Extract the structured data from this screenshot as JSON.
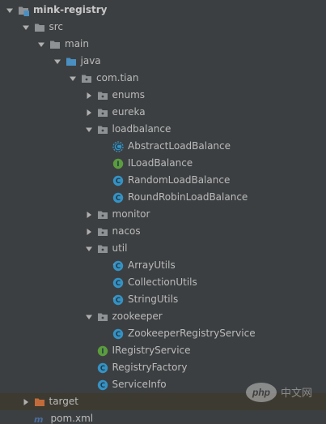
{
  "colors": {
    "background": "#3c3f41",
    "text": "#bbbbbb",
    "folder": "#8f9295",
    "source_folder_accent": "#4a8fc2",
    "excluded_folder": "#c26b3a",
    "class_icon": "#3592c4",
    "interface_icon": "#5b9c3d",
    "maven_icon": "#4a6fa0"
  },
  "tree": [
    {
      "label": "mink-registry",
      "icon": "module-folder-icon",
      "arrow": "down",
      "depth": 0,
      "bold": true
    },
    {
      "label": "src",
      "icon": "folder-icon",
      "arrow": "down",
      "depth": 1
    },
    {
      "label": "main",
      "icon": "folder-icon",
      "arrow": "down",
      "depth": 2
    },
    {
      "label": "java",
      "icon": "source-folder-icon",
      "arrow": "down",
      "depth": 3
    },
    {
      "label": "com.tian",
      "icon": "package-icon",
      "arrow": "down",
      "depth": 4
    },
    {
      "label": "enums",
      "icon": "package-icon",
      "arrow": "right",
      "depth": 5
    },
    {
      "label": "eureka",
      "icon": "package-icon",
      "arrow": "right",
      "depth": 5
    },
    {
      "label": "loadbalance",
      "icon": "package-icon",
      "arrow": "down",
      "depth": 5
    },
    {
      "label": "AbstractLoadBalance",
      "icon": "abstract-class-icon",
      "arrow": "none",
      "depth": 6
    },
    {
      "label": "ILoadBalance",
      "icon": "interface-icon",
      "arrow": "none",
      "depth": 6
    },
    {
      "label": "RandomLoadBalance",
      "icon": "class-icon",
      "arrow": "none",
      "depth": 6
    },
    {
      "label": "RoundRobinLoadBalance",
      "icon": "class-icon",
      "arrow": "none",
      "depth": 6
    },
    {
      "label": "monitor",
      "icon": "package-icon",
      "arrow": "right",
      "depth": 5
    },
    {
      "label": "nacos",
      "icon": "package-icon",
      "arrow": "right",
      "depth": 5
    },
    {
      "label": "util",
      "icon": "package-icon",
      "arrow": "down",
      "depth": 5
    },
    {
      "label": "ArrayUtils",
      "icon": "final-class-icon",
      "arrow": "none",
      "depth": 6
    },
    {
      "label": "CollectionUtils",
      "icon": "class-icon",
      "arrow": "none",
      "depth": 6
    },
    {
      "label": "StringUtils",
      "icon": "final-class-icon",
      "arrow": "none",
      "depth": 6
    },
    {
      "label": "zookeeper",
      "icon": "package-icon",
      "arrow": "down",
      "depth": 5
    },
    {
      "label": "ZookeeperRegistryService",
      "icon": "class-icon",
      "arrow": "none",
      "depth": 6
    },
    {
      "label": "IRegistryService",
      "icon": "interface-icon",
      "arrow": "none",
      "depth": 5
    },
    {
      "label": "RegistryFactory",
      "icon": "class-icon",
      "arrow": "none",
      "depth": 5
    },
    {
      "label": "ServiceInfo",
      "icon": "class-icon",
      "arrow": "none",
      "depth": 5
    },
    {
      "label": "target",
      "icon": "excluded-folder-icon",
      "arrow": "right",
      "depth": 1,
      "excluded": true
    },
    {
      "label": "pom.xml",
      "icon": "maven-file-icon",
      "arrow": "none",
      "depth": 1
    }
  ],
  "watermark": {
    "text": "php",
    "site": "中文网"
  }
}
